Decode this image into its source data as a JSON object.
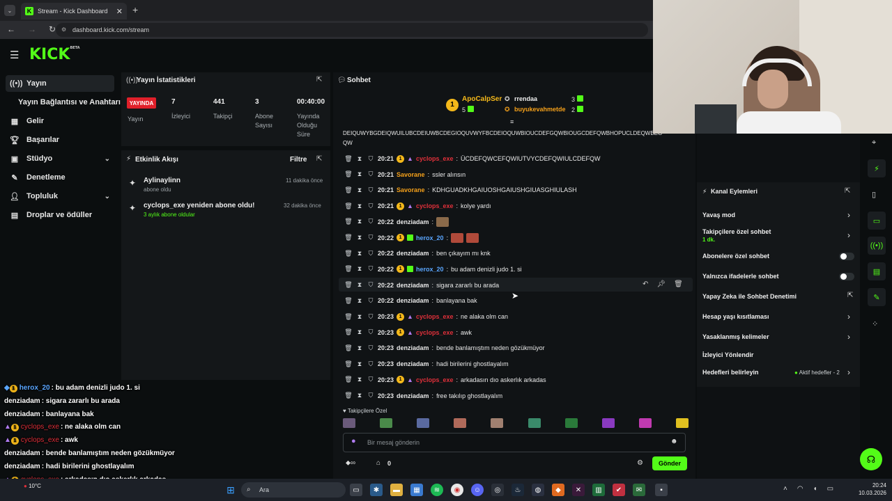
{
  "browser": {
    "tab_title": "Stream - Kick Dashboard",
    "url": "dashboard.kick.com/stream",
    "new_tab": "+",
    "close_tab": "✕"
  },
  "header": {
    "logo": "KICK",
    "logo_tag": "BETA"
  },
  "sidebar": {
    "items": [
      {
        "label": "Yayın",
        "icon": "broadcast-icon"
      },
      {
        "label": "Yayın Bağlantısı ve Anahtarı"
      },
      {
        "label": "Gelir",
        "icon": "revenue-icon"
      },
      {
        "label": "Başarılar",
        "icon": "trophy-icon"
      },
      {
        "label": "Stüdyo",
        "icon": "studio-icon"
      },
      {
        "label": "Denetleme",
        "icon": "moderation-icon"
      },
      {
        "label": "Topluluk",
        "icon": "community-icon"
      },
      {
        "label": "Droplar ve ödüller",
        "icon": "drops-icon"
      }
    ]
  },
  "stats": {
    "title": "Yayın İstatistikleri",
    "live_badge": "YAYINDA",
    "live_label": "Yayın",
    "viewers_value": "7",
    "viewers_label": "İzleyici",
    "followers_value": "441",
    "followers_label": "Takipçi",
    "subs_value": "3",
    "subs_label_1": "Abone",
    "subs_label_2": "Sayısı",
    "uptime_value": "00:40:00",
    "uptime_label_1": "Yayında",
    "uptime_label_2": "Olduğu",
    "uptime_label_3": "Süre"
  },
  "activity": {
    "title": "Etkinlik Akışı",
    "filter": "Filtre",
    "items": [
      {
        "title": "Aylinaylinn",
        "sub": "abone oldu",
        "time": "11 dakika önce"
      },
      {
        "title": "cyclops_exe yeniden abone oldu!",
        "sub": "3 aylık abone oldular",
        "time": "32 dakika önce"
      }
    ]
  },
  "chat": {
    "title": "Sohbet",
    "leaderboard": {
      "top_name": "ApoCalpSer",
      "top_rank": "1",
      "top_count": "5",
      "second_name": "rrendaa",
      "second_count": "3",
      "third_name": "buyukevahmetde",
      "third_count": "2"
    },
    "overflow_line_1": "DEIQUWYBGDEIQWUILUBCDEIUWBCDEGIOQUVWYFBCDEIOQUWBIOUCDEFGQWBIOUGCDEFQWBHOPUCLDEQWBEG",
    "overflow_line_2": "QW",
    "messages": [
      {
        "time": "20:21",
        "user": "cyclops_exe",
        "badges": "op",
        "text": "ÜCDEFQWCEFQWIUTVYCDEFQWIULCDEFQW"
      },
      {
        "time": "20:21",
        "user": "Savorane",
        "badges": "",
        "text": "ssler alınsın"
      },
      {
        "time": "20:21",
        "user": "Savorane",
        "badges": "",
        "text": "KDHGUADKHGAIUOSHGAIUSHGIUASGHIULASH"
      },
      {
        "time": "20:21",
        "user": "cyclops_exe",
        "badges": "op",
        "text": "kolye yardı"
      },
      {
        "time": "20:22",
        "user": "denziadam",
        "badges": "",
        "text": ""
      },
      {
        "time": "20:22",
        "user": "herox_20",
        "badges": "og",
        "text": ""
      },
      {
        "time": "20:22",
        "user": "denziadam",
        "badges": "",
        "text": "ben çıkayım mı knk"
      },
      {
        "time": "20:22",
        "user": "herox_20",
        "badges": "og",
        "text": "bu adam denizli judo 1. si"
      },
      {
        "time": "20:22",
        "user": "denziadam",
        "badges": "",
        "text": "sigara zararlı bu arada"
      },
      {
        "time": "20:22",
        "user": "denziadam",
        "badges": "",
        "text": "banlayana bak"
      },
      {
        "time": "20:23",
        "user": "cyclops_exe",
        "badges": "op",
        "text": "ne alaka olm can"
      },
      {
        "time": "20:23",
        "user": "cyclops_exe",
        "badges": "op",
        "text": "awk"
      },
      {
        "time": "20:23",
        "user": "denziadam",
        "badges": "",
        "text": "bende banlamıştım neden gözükmüyor"
      },
      {
        "time": "20:23",
        "user": "denziadam",
        "badges": "",
        "text": "hadi birilerini ghostlayalım"
      },
      {
        "time": "20:23",
        "user": "cyclops_exe",
        "badges": "op",
        "text": "arkadasın dıo askerlık arkadas"
      },
      {
        "time": "20:23",
        "user": "denziadam",
        "badges": "",
        "text": "free takılıp ghostlayalım"
      }
    ],
    "followers_only_label": "Takipçilere Özel",
    "input_placeholder": "Bir mesaj gönderin",
    "send_label": "Gönder",
    "infinity_label": "∞",
    "points_value": "0"
  },
  "channel_actions": {
    "title": "Kanal Eylemleri",
    "slow_mode": "Yavaş mod",
    "followers_chat": "Takipçilere özel sohbet",
    "followers_chat_sub": "1 dk.",
    "subs_chat": "Abonelere özel sohbet",
    "emote_chat": "Yalnızca ifadelerle sohbet",
    "ai_moderation": "Yapay Zeka ile Sohbet Denetimi",
    "account_age": "Hesap yaşı kısıtlaması",
    "banned_words": "Yasaklanmış kelimeler",
    "redirect": "İzleyici Yönlendir",
    "goals": "Hedefleri belirleyin",
    "goals_status": "Aktif hedefler - 2"
  },
  "overlay_chat": [
    {
      "user": "herox_20",
      "text": ": bu adam denizli judo 1. si"
    },
    {
      "user": "denziadam",
      "text": ": sigara zararlı bu arada"
    },
    {
      "user": "denziadam",
      "text": ": banlayana bak"
    },
    {
      "user": "cyclops_exe",
      "text": ": ne alaka olm can"
    },
    {
      "user": "cyclops_exe",
      "text": ": awk"
    },
    {
      "user": "denziadam",
      "text": ": bende banlamıştım neden gözükmüyor"
    },
    {
      "user": "denziadam",
      "text": ": hadi birilerini ghostlayalım"
    },
    {
      "user": "cyclops_exe",
      "text": ": arkadasın dıo askerlık arkadas"
    },
    {
      "user": "denziadam",
      "text": "free takılıp ghostlayalım"
    }
  ],
  "taskbar": {
    "search": "Ara",
    "weather": "10°C",
    "time": "20:24",
    "date": "10.03.2026"
  },
  "colors": {
    "accent": "#53fc18",
    "live": "#e0202a",
    "badge_orange": "#f4b81a",
    "user_red": "#e0303a",
    "user_blue": "#5aa6ff",
    "user_orange": "#f4a01a"
  }
}
